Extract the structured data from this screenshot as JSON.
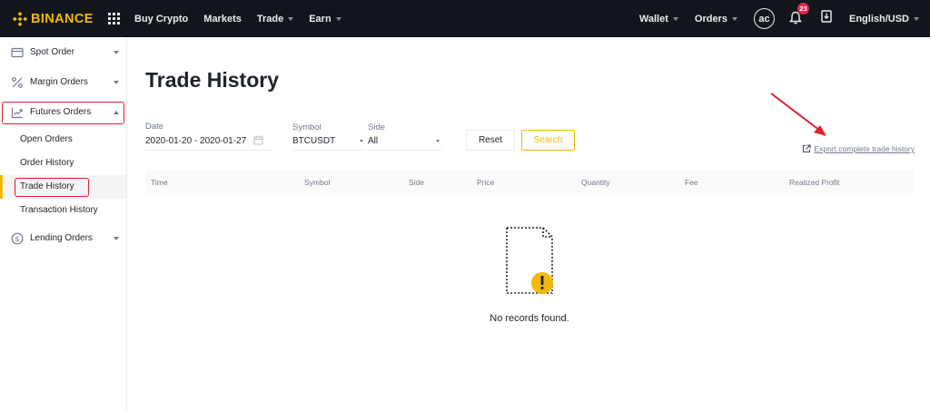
{
  "brand": {
    "name": "BINANCE",
    "accent": "#f0b90b"
  },
  "topnav": {
    "items": [
      {
        "label": "Buy Crypto",
        "caret": false
      },
      {
        "label": "Markets",
        "caret": false
      },
      {
        "label": "Trade",
        "caret": true
      },
      {
        "label": "Earn",
        "caret": true
      }
    ],
    "wallet": "Wallet",
    "orders": "Orders",
    "avatar": "ac",
    "notifications_count": "23",
    "language": "English/USD"
  },
  "sidebar": {
    "groups": [
      {
        "label": "Spot Order",
        "icon": "card-icon"
      },
      {
        "label": "Margin Orders",
        "icon": "percent-icon"
      },
      {
        "label": "Futures Orders",
        "icon": "futures-icon"
      },
      {
        "label": "Lending Orders",
        "icon": "dollar-coin-icon"
      }
    ],
    "futures_sub": [
      {
        "label": "Open Orders"
      },
      {
        "label": "Order History"
      },
      {
        "label": "Trade History",
        "active": true
      },
      {
        "label": "Transaction History"
      }
    ]
  },
  "page": {
    "title": "Trade History"
  },
  "filters": {
    "date_label": "Date",
    "date_value": "2020-01-20 - 2020-01-27",
    "symbol_label": "Symbol",
    "symbol_value": "BTCUSDT",
    "side_label": "Side",
    "side_value": "All",
    "reset_label": "Reset",
    "search_label": "Search"
  },
  "export_label": "Export complete trade history",
  "table": {
    "columns": [
      "Time",
      "Symbol",
      "Side",
      "Price",
      "Quantity",
      "Fee",
      "Realized Profit"
    ]
  },
  "empty_state": {
    "message": "No records found."
  }
}
